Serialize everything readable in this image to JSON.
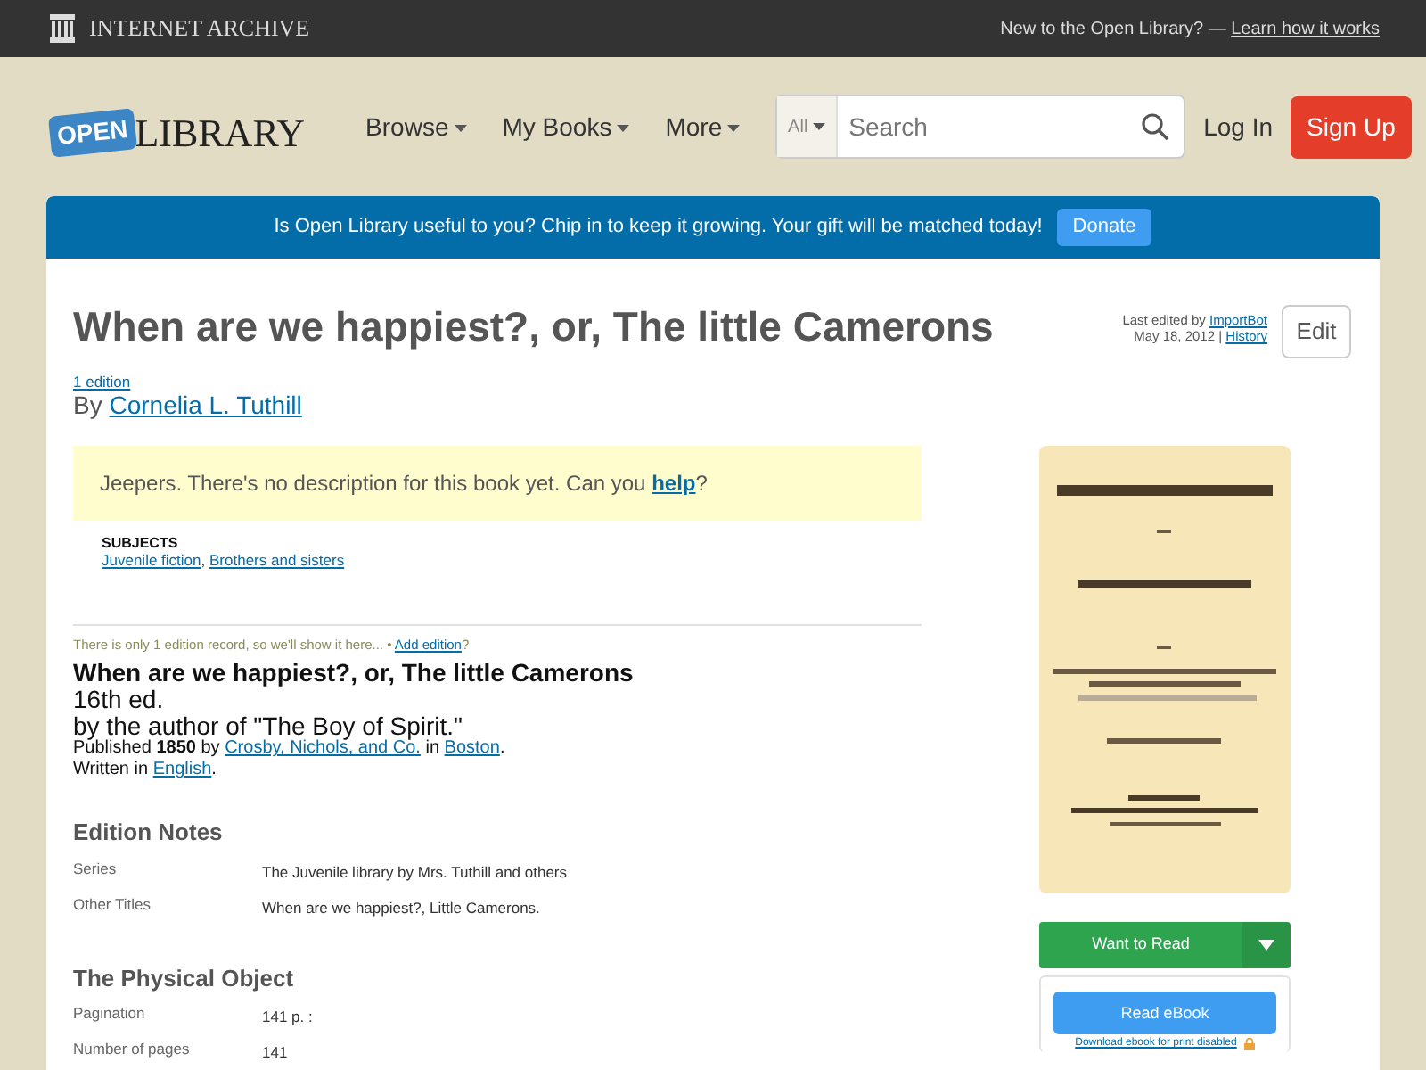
{
  "top_bar": {
    "brand": "INTERNET ARCHIVE",
    "prompt": "New to the Open Library? —",
    "link": "Learn how it works"
  },
  "header": {
    "logo_badge": "OPEN",
    "logo_text": "LIBRARY",
    "nav": [
      {
        "label": "Browse"
      },
      {
        "label": "My Books"
      },
      {
        "label": "More"
      }
    ],
    "search": {
      "scope": "All",
      "placeholder": "Search"
    },
    "login": "Log In",
    "signup": "Sign Up"
  },
  "banner": {
    "message": "Is Open Library useful to you? Chip in to keep it growing. Your gift will be matched today!",
    "button": "Donate"
  },
  "work": {
    "title": "When are we happiest?, or, The little Camerons",
    "edition_count": "1 edition",
    "by": "By",
    "author": "Cornelia L. Tuthill",
    "last_edited": {
      "prefix": "Last edited by",
      "user": "ImportBot",
      "date": "May 18, 2012 |",
      "history": "History"
    },
    "edit_button": "Edit",
    "description": {
      "text": "Jeepers. There's no description for this book yet. Can you",
      "link": "help",
      "end": "?"
    },
    "subjects": {
      "heading": "SUBJECTS",
      "items": [
        "Juvenile fiction",
        "Brothers and sisters"
      ],
      "separator": ","
    }
  },
  "edition": {
    "note": "There is only 1 edition record, so we'll show it here...",
    "separator": "•",
    "add_link": "Add edition",
    "add_suffix": "?",
    "title": "When are we happiest?, or, The little Camerons",
    "edition_name": "16th ed.",
    "by_statement": "by the author of \"The Boy of Spirit.\"",
    "published": {
      "prefix": "Published **1850** by",
      "publisher": "Crosby, Nichols, and Co.",
      "in": "in",
      "place": "Boston",
      "end": "."
    },
    "written": {
      "prefix": "Written in",
      "language": "English",
      "end": "."
    }
  },
  "sections": [
    {
      "heading": "Edition Notes",
      "rows": [
        {
          "label": "Series",
          "value": "The Juvenile library by Mrs. Tuthill and others"
        },
        {
          "label": "Other Titles",
          "value": "When are we happiest?, Little Camerons."
        }
      ]
    },
    {
      "heading": "The Physical Object",
      "rows": [
        {
          "label": "Pagination",
          "value": "141 p. :"
        },
        {
          "label": "Number of pages",
          "value": "141"
        }
      ]
    }
  ],
  "sidebar": {
    "want_to_read": "Want to Read",
    "read_ebook": "Read eBook",
    "download": "Download ebook for print disabled"
  }
}
